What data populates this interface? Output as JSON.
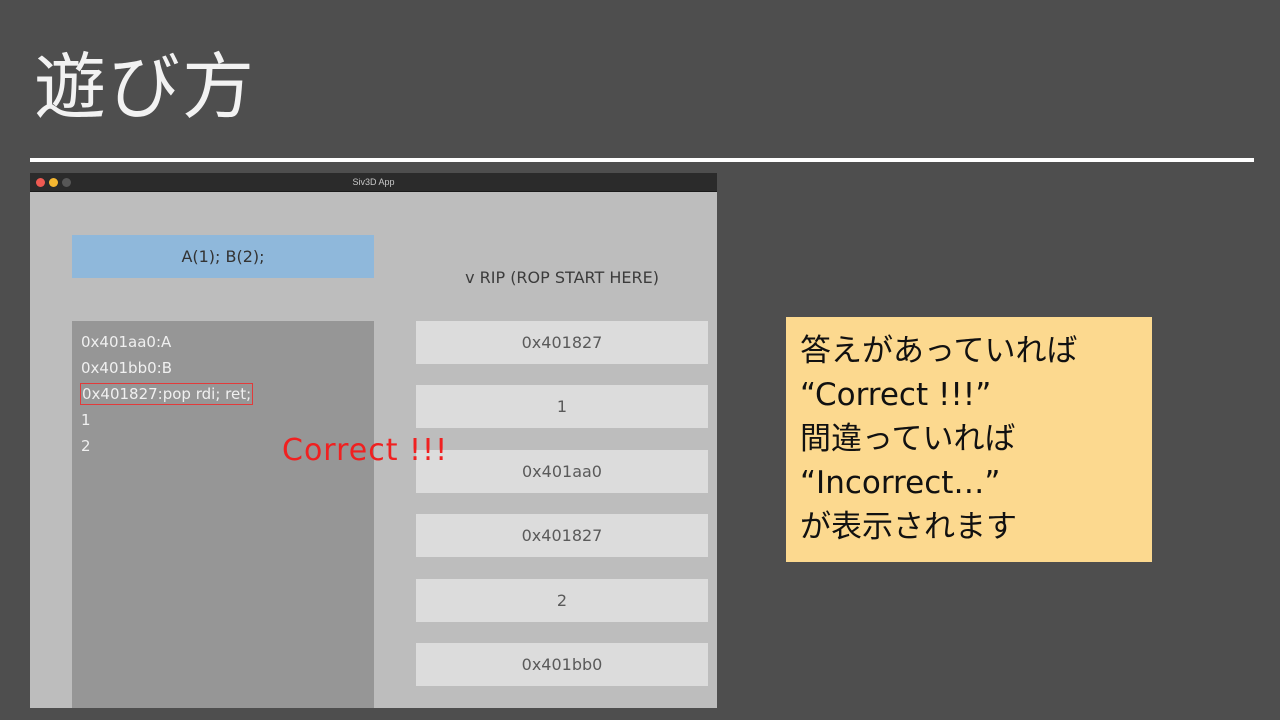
{
  "slide": {
    "title": "遊び方"
  },
  "app": {
    "window_title": "Siv3D App",
    "question": "A(1); B(2);",
    "stack_header": "v RIP (ROP START HERE)",
    "gadgets": [
      "0x401aa0:A",
      "0x401bb0:B",
      "0x401827:pop rdi; ret;",
      "1",
      "2"
    ],
    "selected_gadget_index": 2,
    "stack_slots": [
      "0x401827",
      "1",
      "0x401aa0",
      "0x401827",
      "2",
      "0x401bb0"
    ],
    "result_text": "Correct !!!",
    "result_color": "#f02020"
  },
  "note": {
    "lines": [
      "答えがあっていれば",
      "“Correct !!!”",
      "間違っていれば",
      "“Incorrect…”",
      "が表示されます"
    ],
    "background": "#fcd98f"
  },
  "colors": {
    "slide_background": "#4e4e4e",
    "question_box": "#8fb8db",
    "gadget_panel": "#969696",
    "stack_slot": "#dcdcdc",
    "selection_border": "#e23a3a"
  }
}
